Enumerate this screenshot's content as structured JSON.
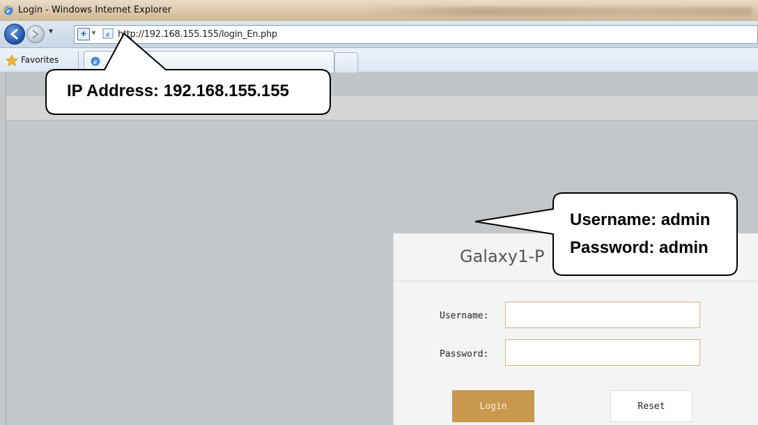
{
  "window": {
    "title": "Login - Windows Internet Explorer",
    "icon": "ie-logo-icon"
  },
  "navbar": {
    "url": "http://192.168.155.155/login_En.php"
  },
  "favorites_bar": {
    "favorites_label": "Favorites"
  },
  "login": {
    "title": "Galaxy1-P",
    "username_label": "Username:",
    "username_value": "",
    "password_label": "Password:",
    "password_value": "",
    "login_button": "Login",
    "reset_button": "Reset"
  },
  "callouts": {
    "ip": "IP Address: 192.168.155.155",
    "username": "Username: admin",
    "password": "Password: admin"
  },
  "colors": {
    "login_button": "#c9994f",
    "field_border": "#d6b277",
    "page_background": "#c4c7ca"
  }
}
